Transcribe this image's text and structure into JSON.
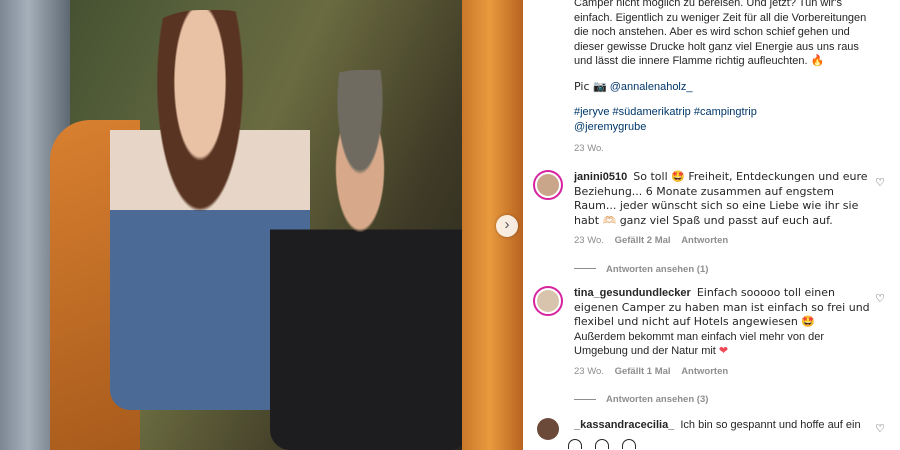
{
  "caption": {
    "lines": [
      "Camper nicht möglich zu bereisen. Und jetzt? Tun wir's einfach. Eigentlich zu weniger Zeit für all die Vorbereitungen die noch anstehen. Aber es wird schon schief gehen und dieser gewisse Drucke holt ganz viel Energie aus uns raus und lässt die innere Flamme richtig aufleuchten. 🔥"
    ],
    "pic_prefix": "Pic 📷",
    "pic_handle": "@annalenaholz_",
    "hashtags": "#jeryve #südamerikatrip #campingtrip",
    "mention": "@jeremygrube",
    "time": "23 Wo."
  },
  "comments": [
    {
      "username": "janini0510",
      "text": "So toll 🤩 Freiheit, Entdeckungen und eure Beziehung... 6 Monate zusammen auf engstem Raum... jeder wünscht sich so eine Liebe wie ihr sie habt 🫶🏻 ganz viel Spaß und passt auf euch auf.",
      "time": "23 Wo.",
      "likes": "Gefällt 2 Mal",
      "reply": "Antworten",
      "view_replies": "Antworten ansehen (1)",
      "avatar_color": "#c9a58a"
    },
    {
      "username": "tina_gesundundlecker",
      "text": "Einfach sooooo toll einen eigenen Camper zu haben man ist einfach so frei und flexibel und nicht auf Hotels angewiesen 🤩",
      "text2": "Außerdem bekommt man einfach viel mehr von der Umgebung und der Natur mit",
      "text2_heart": "❤",
      "time": "23 Wo.",
      "likes": "Gefällt 1 Mal",
      "reply": "Antworten",
      "view_replies": "Antworten ansehen (3)",
      "avatar_color": "#d8c4ad"
    },
    {
      "username": "_kassandracecilia_",
      "text": "Ich bin so gespannt und hoffe auf ein",
      "avatar_color": "#6b4a3a"
    }
  ],
  "icons": {
    "heart": "♡",
    "next": "›"
  }
}
